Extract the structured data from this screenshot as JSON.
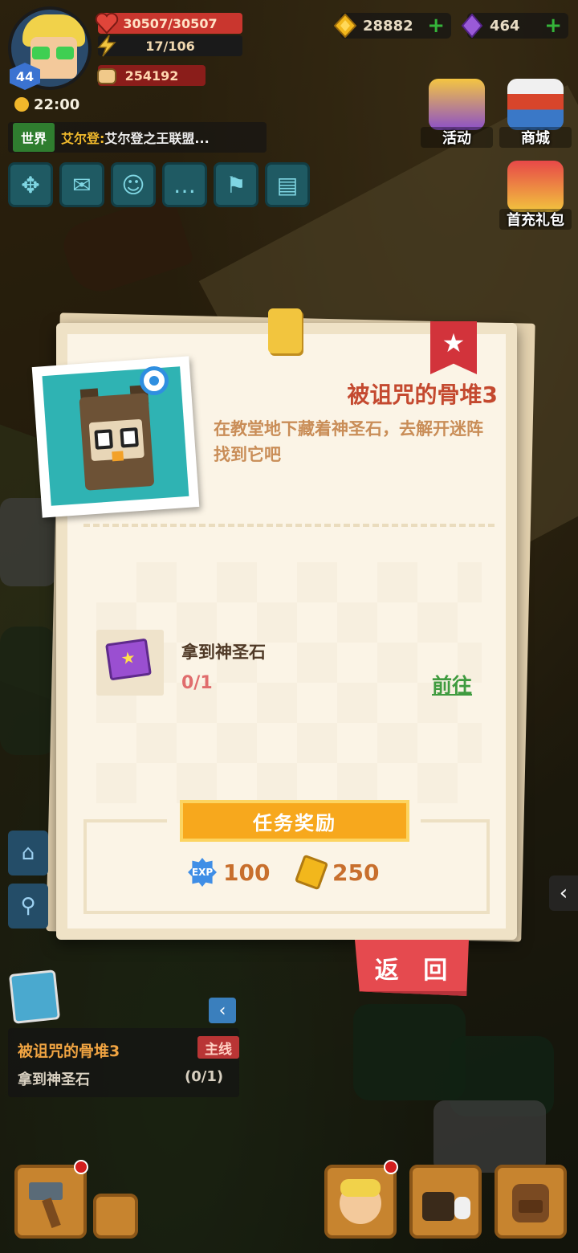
{
  "player": {
    "level": "44",
    "hp": "30507/30507",
    "stamina": "17/106",
    "power": "254192",
    "time": "22:00"
  },
  "currency": {
    "gold": "28882",
    "gems": "464",
    "add_label": "+"
  },
  "chat": {
    "channel": "世界",
    "sender": "艾尔登:",
    "message": " 艾尔登之王联盟..."
  },
  "right_menu": [
    {
      "label": "活动"
    },
    {
      "label": "商城"
    },
    {
      "label": "首充礼包"
    }
  ],
  "quest_dialog": {
    "title": "被诅咒的骨堆3",
    "description": "在教堂地下藏着神圣石，去解开迷阵找到它吧",
    "objective": {
      "name": "拿到神圣石",
      "progress": "0/1",
      "go_label": "前往"
    },
    "reward_header": "任务奖励",
    "rewards": {
      "exp_icon_text": "EXP",
      "exp": "100",
      "gold": "250"
    },
    "back_label": "返 回"
  },
  "quest_tracker": {
    "title": "被诅咒的骨堆3",
    "tag": "主线",
    "objective": "拿到神圣石",
    "count": "(0/1)"
  },
  "icons": {
    "star": "★",
    "collapse": "‹",
    "expand": "‹",
    "home": "⌂",
    "location": "⚲"
  },
  "colors": {
    "title_red": "#c4492f",
    "desc_orange": "#c98d57",
    "go_green": "#3f9b3f",
    "reward_orange": "#f7a81d",
    "back_red": "#e54a4f"
  }
}
